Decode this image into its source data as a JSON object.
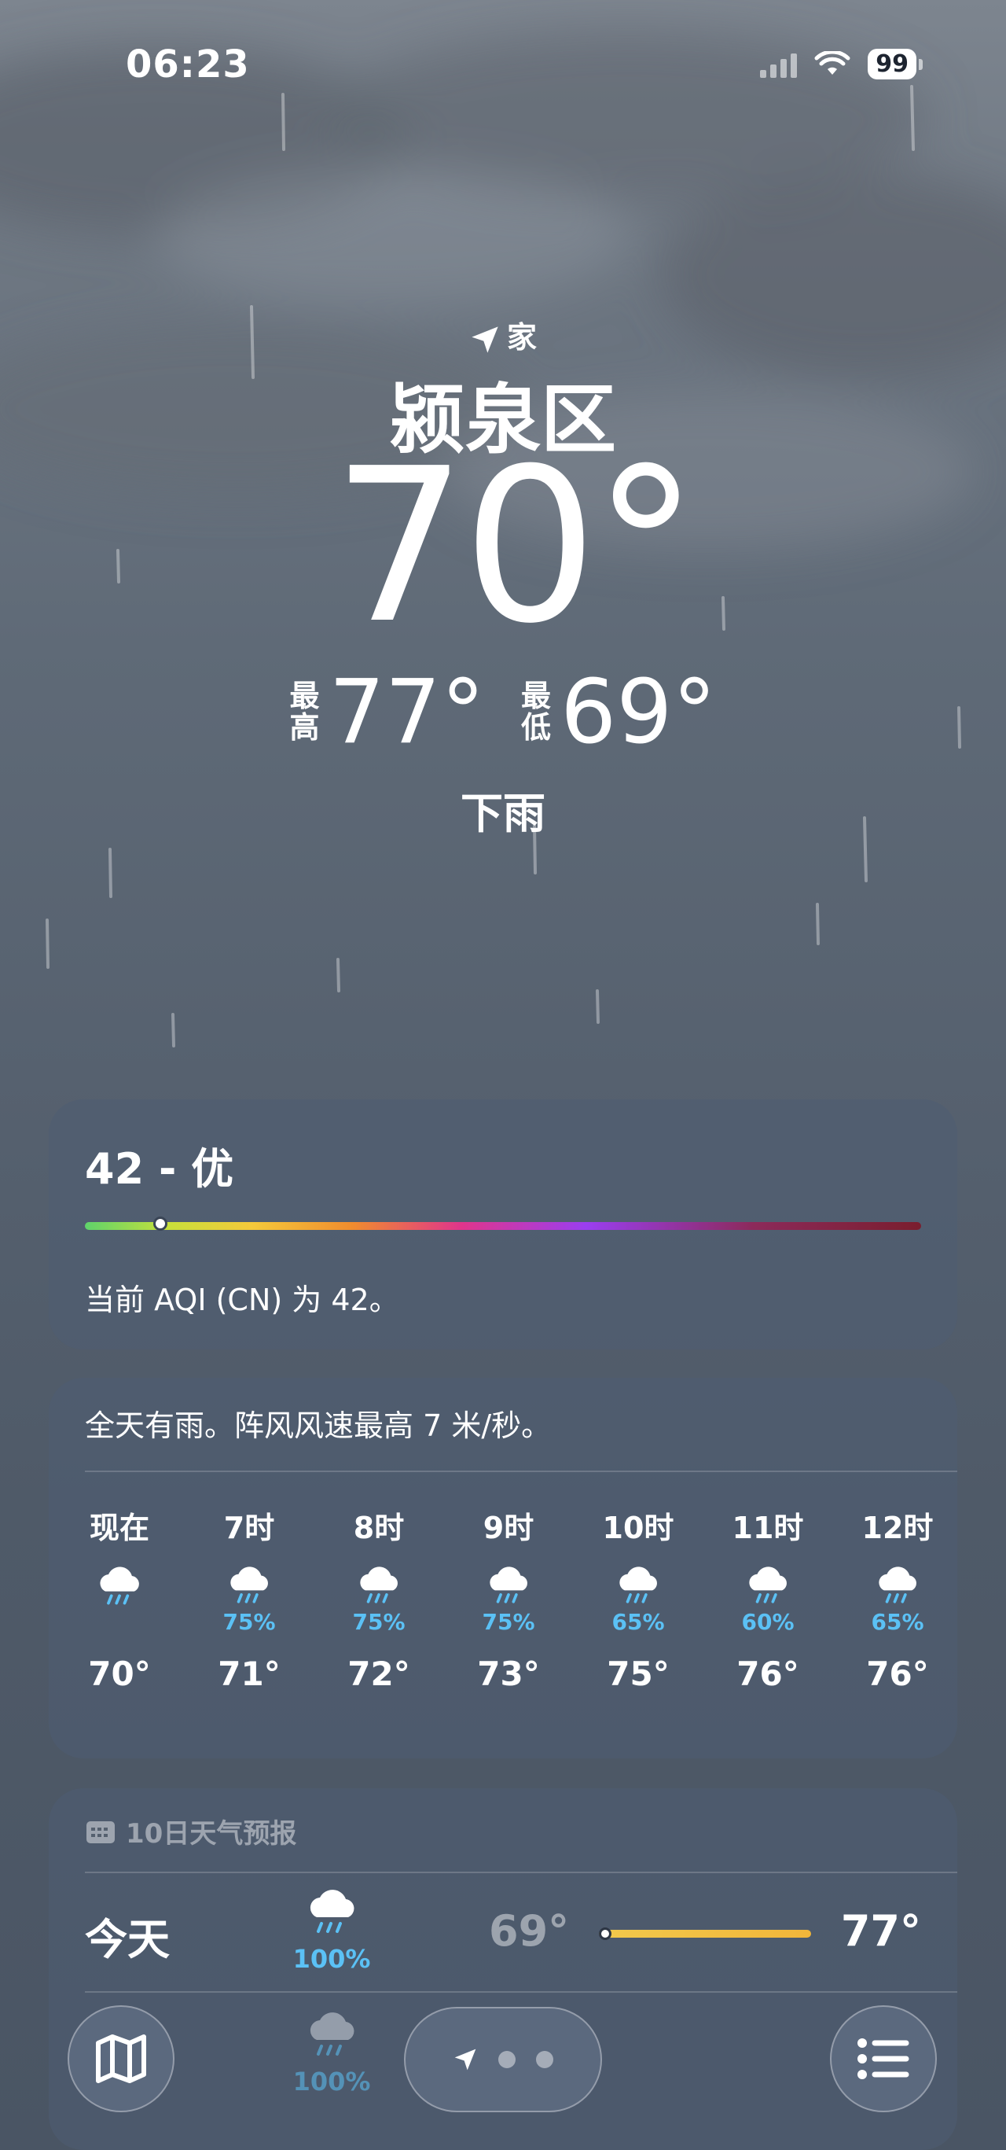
{
  "status_bar": {
    "time": "06:23",
    "battery": "99"
  },
  "location": {
    "label": "家",
    "city": "颍泉区"
  },
  "current": {
    "temp": "70°",
    "high_label": "最高",
    "high": "77°",
    "low_label": "最低",
    "low": "69°",
    "condition": "下雨"
  },
  "aqi": {
    "title": "42 - 优",
    "description": "当前 AQI (CN) 为 42。",
    "level_fraction": 0.09
  },
  "hourly": {
    "summary": "全天有雨。阵风风速最高 7 米/秒。",
    "items": [
      {
        "time": "现在",
        "icon": "rain-cloud-icon",
        "pct": "",
        "temp": "70°"
      },
      {
        "time": "7时",
        "icon": "rain-cloud-icon",
        "pct": "75%",
        "temp": "71°"
      },
      {
        "time": "8时",
        "icon": "rain-cloud-icon",
        "pct": "75%",
        "temp": "72°"
      },
      {
        "time": "9时",
        "icon": "rain-cloud-icon",
        "pct": "75%",
        "temp": "73°"
      },
      {
        "time": "10时",
        "icon": "rain-cloud-icon",
        "pct": "65%",
        "temp": "75°"
      },
      {
        "time": "11时",
        "icon": "rain-cloud-icon",
        "pct": "60%",
        "temp": "76°"
      },
      {
        "time": "12时",
        "icon": "rain-cloud-icon",
        "pct": "65%",
        "temp": "76°"
      }
    ]
  },
  "daily": {
    "header": "10日天气预报",
    "today": {
      "day": "今天",
      "icon": "rain-cloud-icon",
      "pct": "100%",
      "low": "69°",
      "high": "77°",
      "bar_start": 0.0,
      "bar_end": 1.0,
      "current_marker": 0.0
    },
    "next_pct": "100%"
  },
  "toolbar": {
    "map": "map-icon",
    "location": "location-arrow-icon",
    "list": "list-icon"
  },
  "colors": {
    "precip": "#5bc1f5",
    "aqi_good": "#5fd36b",
    "temp_bar": "#f2c94c"
  }
}
